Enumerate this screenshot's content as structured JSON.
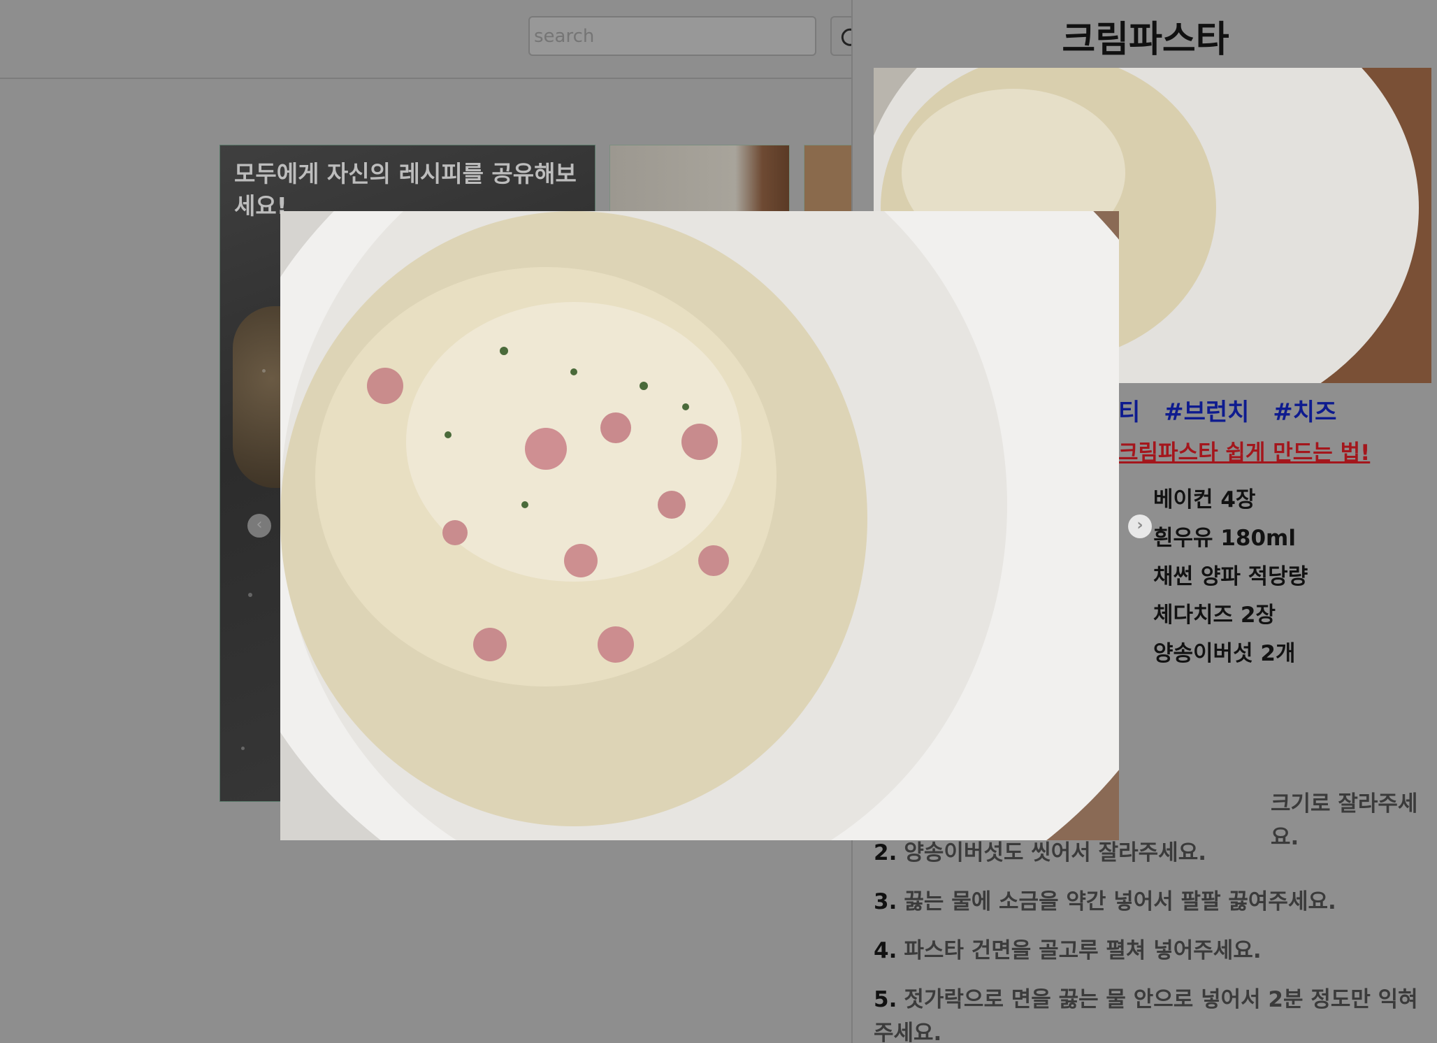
{
  "search": {
    "placeholder": "search"
  },
  "card": {
    "title": "모두에게 자신의 레시피를 공유해보세요!"
  },
  "panel": {
    "title": "크림파스타",
    "tags": [
      "티",
      "#브런치",
      "#치즈"
    ],
    "video_link": "크림파스타 쉽게 만드는 법!",
    "ingredients": [
      "베이컨 4장",
      "흰우유 180ml",
      "채썬 양파 적당량",
      "체다치즈 2장",
      "양송이버섯 2개"
    ],
    "steps": [
      {
        "num": "",
        "text": "크기로 잘라주세요."
      },
      {
        "num": "2.",
        "text": "양송이버섯도 씻어서 잘라주세요."
      },
      {
        "num": "3.",
        "text": "끓는 물에 소금을 약간 넣어서 팔팔 끓여주세요."
      },
      {
        "num": "4.",
        "text": "파스타 건면을 골고루 펼쳐 넣어주세요."
      },
      {
        "num": "5.",
        "text": "젓가락으로 면을 끓는 물 안으로 넣어서 2분 정도만 익혀주세요."
      }
    ]
  },
  "icons": {
    "refresh": "refresh-icon",
    "prev": "chevron-left-icon",
    "next": "chevron-right-icon"
  }
}
